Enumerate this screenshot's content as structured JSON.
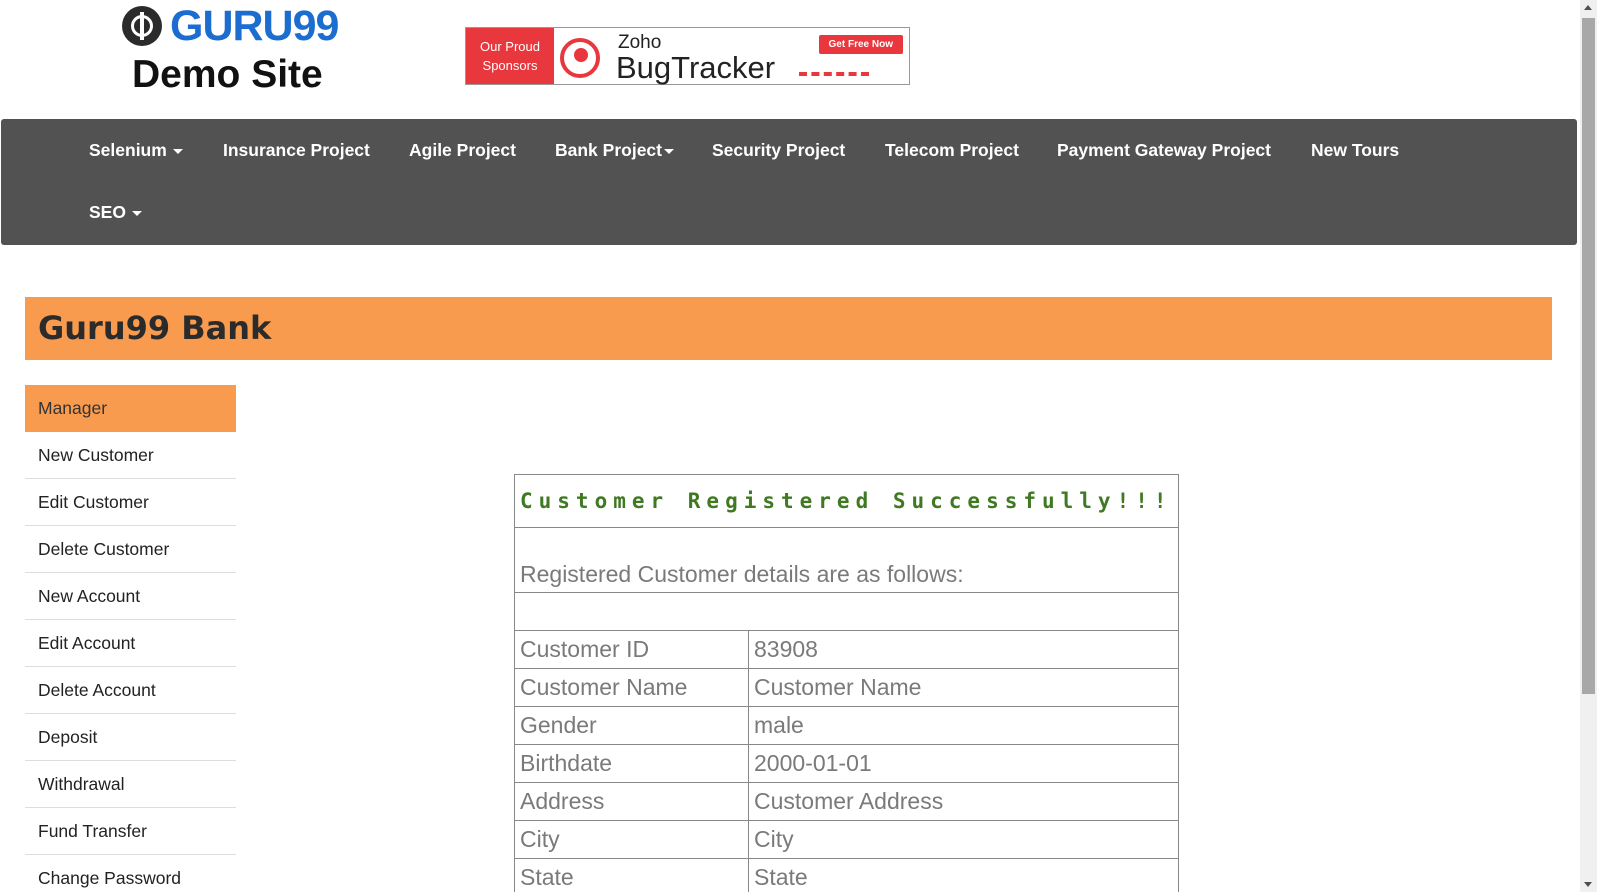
{
  "header": {
    "logo_text": "GURU99",
    "logo_sub": "Demo Site",
    "banner": {
      "left_line1": "Our Proud",
      "left_line2": "Sponsors",
      "brand": "Zoho",
      "product": "BugTracker",
      "cta": "Get Free Now"
    }
  },
  "nav": {
    "items": [
      {
        "label": "Selenium",
        "dropdown": true
      },
      {
        "label": "Insurance Project"
      },
      {
        "label": "Agile Project"
      },
      {
        "label": "Bank Project",
        "dropdown": true
      },
      {
        "label": "Security Project"
      },
      {
        "label": "Telecom Project"
      },
      {
        "label": "Payment Gateway Project"
      },
      {
        "label": "New Tours"
      },
      {
        "label": "SEO",
        "dropdown": true
      }
    ]
  },
  "bank": {
    "title": "Guru99 Bank"
  },
  "sidebar": {
    "items": [
      {
        "label": "Manager",
        "active": true
      },
      {
        "label": "New Customer"
      },
      {
        "label": "Edit Customer"
      },
      {
        "label": "Delete Customer"
      },
      {
        "label": "New Account"
      },
      {
        "label": "Edit Account"
      },
      {
        "label": "Delete Account"
      },
      {
        "label": "Deposit"
      },
      {
        "label": "Withdrawal"
      },
      {
        "label": "Fund Transfer"
      },
      {
        "label": "Change Password"
      }
    ]
  },
  "result": {
    "heading": "Customer Registered Successfully!!!",
    "subheading": "Registered Customer details are as follows:",
    "rows": [
      {
        "label": "Customer ID",
        "value": "83908"
      },
      {
        "label": "Customer Name",
        "value": "Customer Name"
      },
      {
        "label": "Gender",
        "value": "male"
      },
      {
        "label": "Birthdate",
        "value": "2000-01-01"
      },
      {
        "label": "Address",
        "value": "Customer Address"
      },
      {
        "label": "City",
        "value": "City"
      },
      {
        "label": "State",
        "value": "State"
      }
    ]
  },
  "colors": {
    "accent_orange": "#f89b4e",
    "nav_bg": "#525252",
    "success_green": "#3f7a22",
    "logo_blue": "#1c6dd0"
  }
}
